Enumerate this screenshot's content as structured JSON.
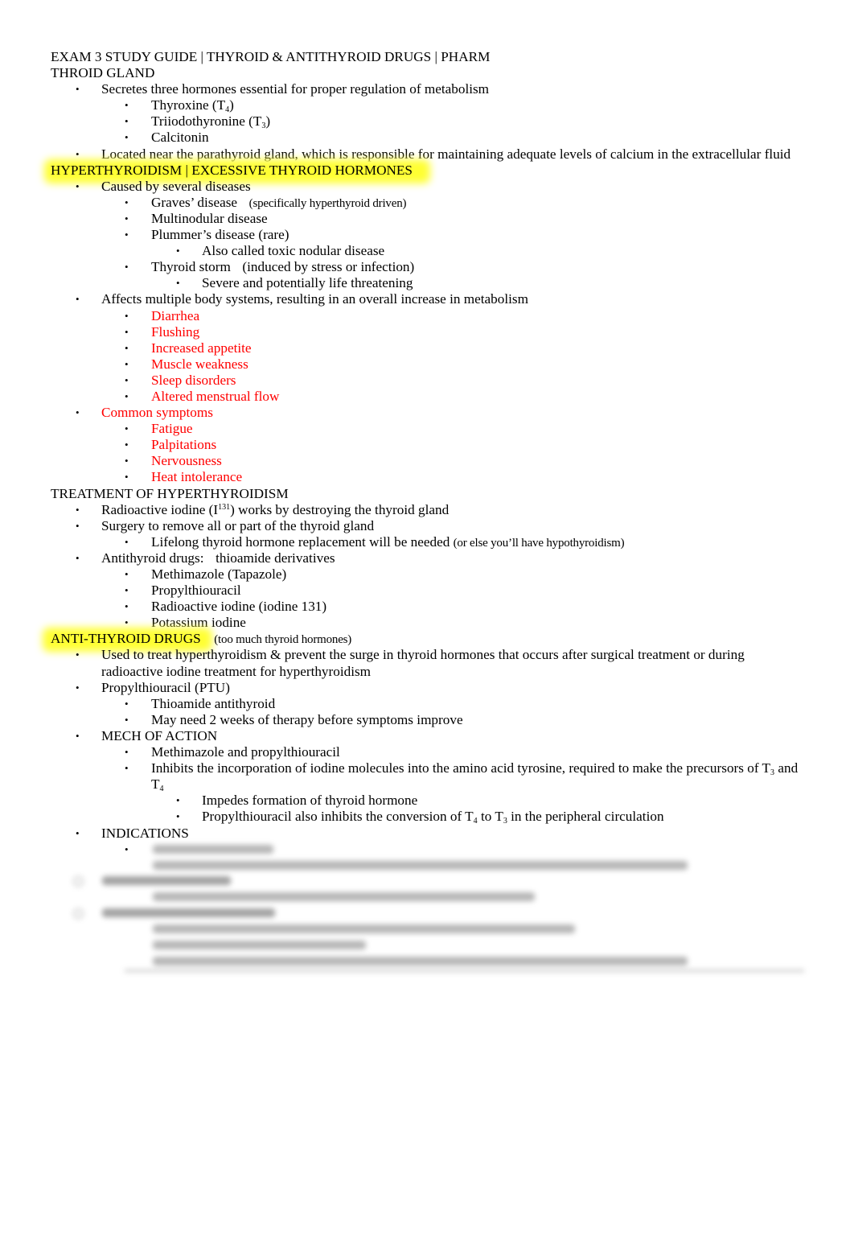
{
  "document": {
    "title": "EXAM 3 STUDY GUIDE | THYROID & ANTITHYROID DRUGS | PHARM",
    "accent_colors": {
      "highlight": "#ffff33",
      "emphasis_text": "#ff0000"
    },
    "section_thyroid_gland": {
      "heading": "THROID GLAND",
      "item1": "Secretes three hormones essential for proper regulation of metabolism",
      "hormones": [
        {
          "name": "Thyroxine (T",
          "sub": "4",
          "tail": ")"
        },
        {
          "name": "Triiodothyronine (T",
          "sub": "3",
          "tail": ")"
        },
        {
          "name": "Calcitonin",
          "sub": "",
          "tail": ""
        }
      ],
      "item2": "Located near the parathyroid gland, which is responsible for maintaining adequate levels of calcium in the extracellular fluid"
    },
    "section_hyperthyroidism": {
      "heading": "HYPERTHYROIDISM | EXCESSIVE THYROID HORMONES",
      "caused_by": "Caused by several diseases",
      "diseases": {
        "graves": "Graves’ disease",
        "graves_note": "(specifically hyperthyroid driven)",
        "multinodular": "Multinodular disease",
        "plummers": "Plummer’s disease (rare)",
        "plummers_sub": "Also called toxic nodular disease",
        "storm": "Thyroid storm",
        "storm_note": "(induced by stress or infection)",
        "storm_sub": "Severe and potentially life threatening"
      },
      "affects": "Affects multiple body systems, resulting in an overall increase in metabolism",
      "effects": [
        "Diarrhea",
        "Flushing",
        "Increased appetite",
        "Muscle weakness",
        "Sleep disorders",
        "Altered menstrual flow"
      ],
      "common_symptoms_label": "Common symptoms",
      "common_symptoms": [
        "Fatigue",
        "Palpitations",
        "Nervousness",
        "Heat intolerance"
      ]
    },
    "section_treatment": {
      "heading": "TREATMENT OF HYPERTHYROIDISM",
      "radioactive_pre": "Radioactive iodine (I",
      "radioactive_sup": "131",
      "radioactive_post": ") works by destroying the thyroid gland",
      "surgery": "Surgery to remove all or part of the thyroid gland",
      "surgery_sub": "Lifelong thyroid hormone replacement will be needed",
      "surgery_sub_note": "(or else you’ll have hypothyroidism)",
      "antithyroid_label": "Antithyroid drugs:",
      "antithyroid_value": "thioamide derivatives",
      "drugs": [
        "Methimazole (Tapazole)",
        "Propylthiouracil",
        "Radioactive iodine (iodine 131)",
        "Potassium iodine"
      ]
    },
    "section_antithyroid": {
      "heading": "ANTI-THYROID DRUGS",
      "heading_note": "(too much thyroid hormones)",
      "used_line1": "Used to treat hyperthyroidism & prevent the surge in thyroid hormones that occurs after surgical treatment or during",
      "used_line2": "radioactive iodine treatment for hyperthyroidism",
      "ptu": "Propylthiouracil (PTU)",
      "ptu_subs": [
        "Thioamide antithyroid",
        "May need 2 weeks of therapy before symptoms improve"
      ],
      "moa": "MECH OF ACTION",
      "moa_sub1": "Methimazole and propylthiouracil",
      "moa_sub2_line1_pre": "Inhibits the incorporation of iodine molecules into the amino acid tyrosine, required to make the precursors of T",
      "moa_sub2_line1_sub": "3",
      "moa_sub2_line1_post": " and",
      "moa_sub2_line2": "T",
      "moa_sub2_line2_sub": "4",
      "moa_sub3": "Impedes formation of thyroid hormone",
      "moa_sub4_pre": "Propylthiouracil also inhibits the conversion of T",
      "moa_sub4_sub1": "4",
      "moa_sub4_mid": " to T",
      "moa_sub4_sub2": "3",
      "moa_sub4_post": " in the peripheral circulation",
      "indications": "INDICATIONS"
    },
    "bullet_glyph": "•"
  }
}
